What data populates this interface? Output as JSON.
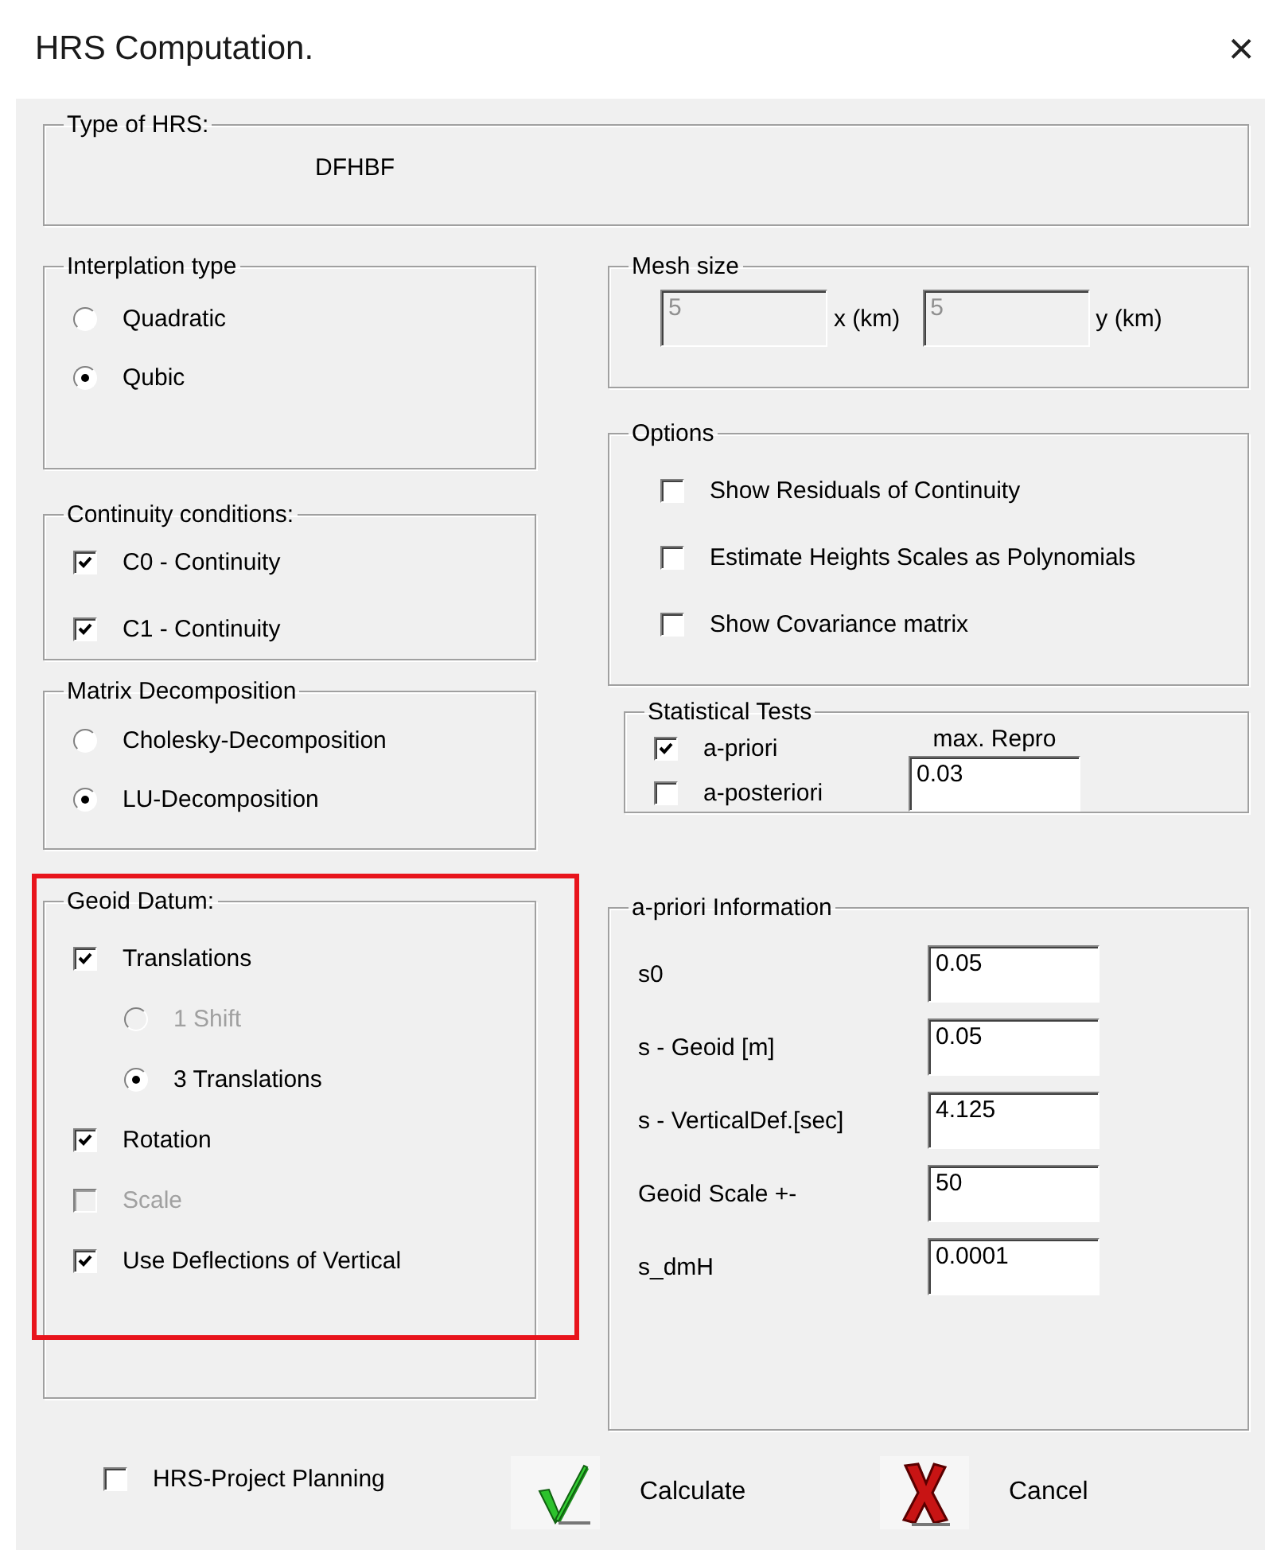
{
  "window": {
    "title": "HRS Computation.",
    "close": "×"
  },
  "type_of_hrs": {
    "label": "Type of HRS:",
    "value": "DFHBF"
  },
  "interpolation_type": {
    "label": "Interplation type",
    "options": [
      {
        "label": "Quadratic",
        "selected": false
      },
      {
        "label": "Qubic",
        "selected": true
      }
    ]
  },
  "mesh_size": {
    "label": "Mesh size",
    "fields": [
      {
        "value": "5",
        "unit": "x (km)",
        "disabled": true
      },
      {
        "value": "5",
        "unit": "y (km)",
        "disabled": true
      }
    ]
  },
  "options": {
    "label": "Options",
    "items": [
      {
        "label": "Show Residuals of Continuity",
        "checked": false
      },
      {
        "label": "Estimate Heights Scales as Polynomials",
        "checked": false
      },
      {
        "label": "Show Covariance matrix",
        "checked": false
      }
    ]
  },
  "continuity_conditions": {
    "label": "Continuity conditions:",
    "items": [
      {
        "label": "C0 - Continuity",
        "checked": true
      },
      {
        "label": "C1 - Continuity",
        "checked": true
      }
    ]
  },
  "matrix_decomposition": {
    "label": "Matrix Decomposition",
    "options": [
      {
        "label": "Cholesky-Decomposition",
        "selected": false
      },
      {
        "label": "LU-Decomposition",
        "selected": true
      }
    ]
  },
  "statistical_tests": {
    "label": "Statistical Tests",
    "items": [
      {
        "label": "a-priori",
        "checked": true
      },
      {
        "label": "a-posteriori",
        "checked": false
      }
    ],
    "field": {
      "label": "max. Repro",
      "value": "0.03"
    }
  },
  "geoid_datum": {
    "label": "Geoid Datum:",
    "highlighted": true,
    "items": [
      {
        "kind": "checkbox",
        "label": "Translations",
        "checked": true,
        "disabled": false,
        "children": [
          {
            "kind": "radio",
            "label": "1 Shift",
            "selected": false,
            "disabled": true
          },
          {
            "kind": "radio",
            "label": "3 Translations",
            "selected": true,
            "disabled": false
          }
        ]
      },
      {
        "kind": "checkbox",
        "label": "Rotation",
        "checked": true,
        "disabled": false
      },
      {
        "kind": "checkbox",
        "label": "Scale",
        "checked": false,
        "disabled": true
      },
      {
        "kind": "checkbox",
        "label": "Use Deflections of Vertical",
        "checked": true,
        "disabled": false
      }
    ]
  },
  "apriori_information": {
    "label": "a-priori Information",
    "fields": [
      {
        "label": "s0",
        "value": "0.05"
      },
      {
        "label": "s - Geoid [m]",
        "value": "0.05"
      },
      {
        "label": "s - VerticalDef.[sec]",
        "value": "4.125"
      },
      {
        "label": "Geoid Scale +-",
        "value": "50"
      },
      {
        "label": "s_dmH",
        "value": "0.0001"
      }
    ]
  },
  "project_planning": {
    "label": "HRS-Project Planning",
    "checked": false
  },
  "buttons": [
    {
      "kind": "calculate",
      "label": "Calculate"
    },
    {
      "kind": "cancel",
      "label": "Cancel"
    }
  ]
}
